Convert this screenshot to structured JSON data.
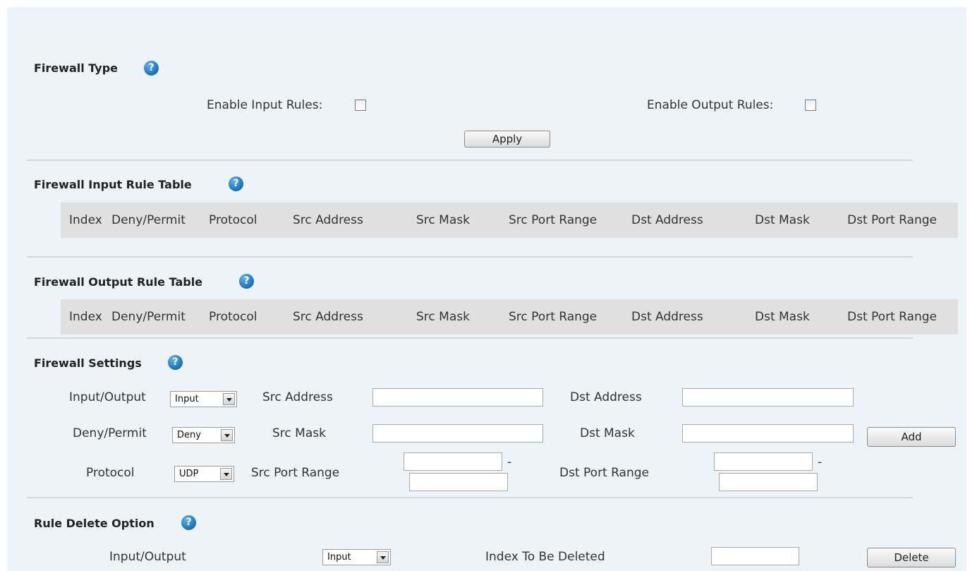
{
  "firewall_type": {
    "title": "Firewall Type",
    "enable_input_label": "Enable Input Rules:",
    "enable_input_checked": false,
    "enable_output_label": "Enable Output Rules:",
    "enable_output_checked": false,
    "apply_label": "Apply"
  },
  "input_table": {
    "title": "Firewall Input Rule Table",
    "columns": [
      "Index",
      "Deny/Permit",
      "Protocol",
      "Src Address",
      "Src Mask",
      "Src Port Range",
      "Dst Address",
      "Dst Mask",
      "Dst Port Range"
    ]
  },
  "output_table": {
    "title": "Firewall Output Rule Table",
    "columns": [
      "Index",
      "Deny/Permit",
      "Protocol",
      "Src Address",
      "Src Mask",
      "Src Port Range",
      "Dst Address",
      "Dst Mask",
      "Dst Port Range"
    ]
  },
  "settings": {
    "title": "Firewall Settings",
    "io_label": "Input/Output",
    "io_value": "Input",
    "deny_label": "Deny/Permit",
    "deny_value": "Deny",
    "protocol_label": "Protocol",
    "protocol_value": "UDP",
    "src_address_label": "Src Address",
    "src_mask_label": "Src Mask",
    "src_port_label": "Src Port Range",
    "dst_address_label": "Dst Address",
    "dst_mask_label": "Dst Mask",
    "dst_port_label": "Dst Port Range",
    "range_separator": "-",
    "add_label": "Add"
  },
  "delete_option": {
    "title": "Rule Delete Option",
    "io_label": "Input/Output",
    "io_value": "Input",
    "index_label": "Index To Be Deleted",
    "delete_label": "Delete"
  },
  "icons": {
    "help": "help-question-icon"
  },
  "colors": {
    "background": "#edf3f6",
    "table_header": "#e0e0e0",
    "help_icon": "#1670b9"
  }
}
